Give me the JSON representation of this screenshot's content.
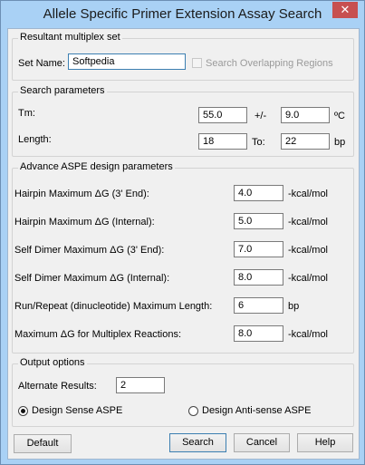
{
  "window": {
    "title": "Allele Specific Primer Extension Assay Search",
    "close_glyph": "✕"
  },
  "resultant": {
    "legend": "Resultant multiplex set",
    "set_name_label": "Set Name:",
    "set_name_value": "Softpedia",
    "overlap_label": "Search Overlapping Regions"
  },
  "search": {
    "legend": "Search parameters",
    "tm_label": "Tm:",
    "tm_value": "55.0",
    "pm_label": "+/-",
    "pm_value": "9.0",
    "tm_unit": "ºC",
    "length_label": "Length:",
    "length_from": "18",
    "to_label": "To:",
    "length_to": "22",
    "length_unit": "bp"
  },
  "advance": {
    "legend": "Advance ASPE design parameters",
    "rows": [
      {
        "label": "Hairpin Maximum  ΔG (3' End):",
        "value": "4.0",
        "unit": "-kcal/mol"
      },
      {
        "label": "Hairpin Maximum  ΔG (Internal):",
        "value": "5.0",
        "unit": "-kcal/mol"
      },
      {
        "label": "Self Dimer Maximum  ΔG (3' End):",
        "value": "7.0",
        "unit": "-kcal/mol"
      },
      {
        "label": "Self Dimer Maximum  ΔG (Internal):",
        "value": "8.0",
        "unit": "-kcal/mol"
      },
      {
        "label": "Run/Repeat (dinucleotide) Maximum Length:",
        "value": "6",
        "unit": "bp"
      },
      {
        "label": "Maximum ΔG for Multiplex Reactions:",
        "value": "8.0",
        "unit": "-kcal/mol"
      }
    ]
  },
  "output": {
    "legend": "Output options",
    "alt_label": "Alternate Results:",
    "alt_value": "2",
    "sense_label": "Design Sense ASPE",
    "antisense_label": "Design Anti-sense ASPE"
  },
  "buttons": {
    "default": "Default",
    "search": "Search",
    "cancel": "Cancel",
    "help": "Help"
  }
}
